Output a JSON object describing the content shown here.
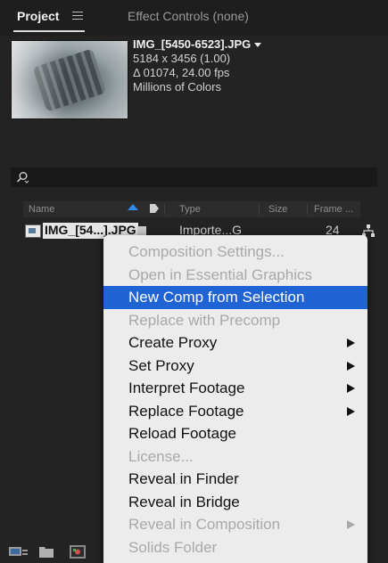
{
  "tabs": {
    "project": "Project",
    "effect_controls": "Effect Controls (none)"
  },
  "preview": {
    "filename": "IMG_[5450-6523].JPG",
    "dimensions": "5184 x 3456 (1.00)",
    "duration": "Δ 01074, 24.00 fps",
    "colors": "Millions of Colors"
  },
  "search": {
    "placeholder": ""
  },
  "columns": {
    "name": "Name",
    "type": "Type",
    "size": "Size",
    "frame": "Frame ..."
  },
  "row": {
    "name": "IMG_[54...].JPG",
    "type": "Importe...G",
    "frame": "24"
  },
  "menu": {
    "items": [
      {
        "label": "Composition Settings...",
        "disabled": true,
        "submenu": false
      },
      {
        "label": "Open in Essential Graphics",
        "disabled": true,
        "submenu": false
      },
      {
        "label": "New Comp from Selection",
        "disabled": false,
        "submenu": false,
        "highlighted": true
      },
      {
        "label": "Replace with Precomp",
        "disabled": true,
        "submenu": false
      },
      {
        "label": "Create Proxy",
        "disabled": false,
        "submenu": true
      },
      {
        "label": "Set Proxy",
        "disabled": false,
        "submenu": true
      },
      {
        "label": "Interpret Footage",
        "disabled": false,
        "submenu": true
      },
      {
        "label": "Replace Footage",
        "disabled": false,
        "submenu": true
      },
      {
        "label": "Reload Footage",
        "disabled": false,
        "submenu": false
      },
      {
        "label": "License...",
        "disabled": true,
        "submenu": false
      },
      {
        "label": "Reveal in Finder",
        "disabled": false,
        "submenu": false
      },
      {
        "label": "Reveal in Bridge",
        "disabled": false,
        "submenu": false
      },
      {
        "label": "Reveal in Composition",
        "disabled": true,
        "submenu": true
      },
      {
        "label": "Solids Folder",
        "disabled": true,
        "submenu": false
      }
    ]
  },
  "colors": {
    "panel_bg": "#232323",
    "menu_bg": "#ececec",
    "highlight": "#2063d5",
    "sort_accent": "#2d8ceb"
  }
}
